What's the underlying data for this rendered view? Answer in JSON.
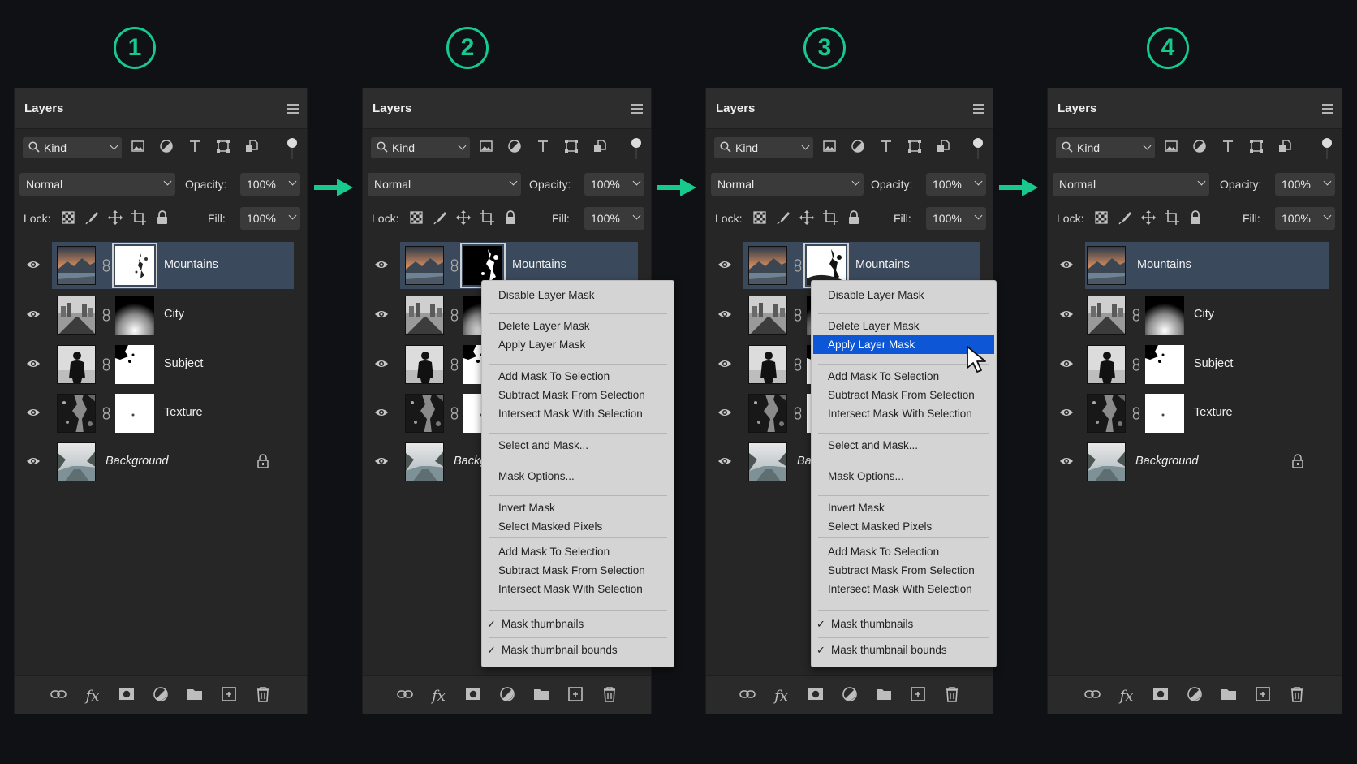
{
  "steps": [
    "1",
    "2",
    "3",
    "4"
  ],
  "panel": {
    "title": "Layers",
    "filter_label": "Kind",
    "blend_mode": "Normal",
    "opacity_label": "Opacity:",
    "opacity_value": "100%",
    "lock_label": "Lock:",
    "fill_label": "Fill:",
    "fill_value": "100%"
  },
  "layers": [
    {
      "name": "Mountains",
      "selected": true
    },
    {
      "name": "City"
    },
    {
      "name": "Subject"
    },
    {
      "name": "Texture"
    },
    {
      "name": "Background",
      "locked": true
    }
  ],
  "context_menu": {
    "items": [
      "Disable Layer Mask",
      "Delete Layer Mask",
      "Apply Layer Mask",
      "Add Mask To Selection",
      "Subtract Mask From Selection",
      "Intersect Mask With Selection",
      "Select and Mask...",
      "Mask Options...",
      "Invert Mask",
      "Select Masked Pixels",
      "Add Mask To Selection",
      "Subtract Mask From Selection",
      "Intersect Mask With Selection",
      "Mask thumbnails",
      "Mask thumbnail bounds"
    ],
    "highlighted_item": "Apply Layer Mask",
    "checked_items": [
      "Mask thumbnails",
      "Mask thumbnail bounds"
    ]
  },
  "colors": {
    "accent_green": "#17c98c",
    "selection_blue": "#0d57d6",
    "selected_layer": "#3a4a5c",
    "panel_bg": "#262626"
  },
  "icons": {
    "filter": [
      "image-filter-icon",
      "adjustment-filter-icon",
      "type-filter-icon",
      "shape-filter-icon",
      "smart-object-filter-icon"
    ],
    "lock": [
      "lock-transparent-icon",
      "lock-image-icon",
      "lock-position-icon",
      "lock-artboard-icon",
      "lock-all-icon"
    ],
    "footer": [
      "link-layers-icon",
      "fx-icon",
      "add-mask-icon",
      "adjustment-layer-icon",
      "new-group-icon",
      "new-layer-icon",
      "delete-layer-icon"
    ]
  }
}
